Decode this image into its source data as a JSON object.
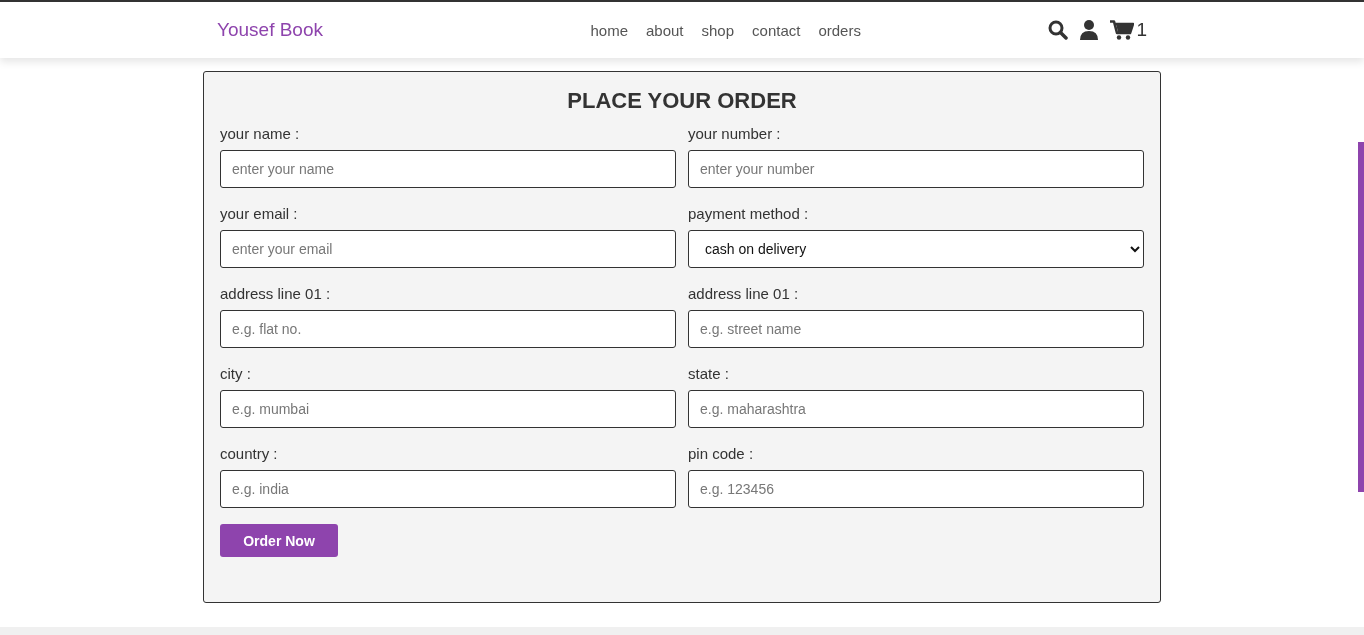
{
  "header": {
    "logo": "Yousef Book",
    "nav": [
      {
        "label": "home"
      },
      {
        "label": "about"
      },
      {
        "label": "shop"
      },
      {
        "label": "contact"
      },
      {
        "label": "orders"
      }
    ],
    "cart_count": "1"
  },
  "form": {
    "title": "PLACE YOUR ORDER",
    "fields": [
      {
        "kind": "input",
        "label": "your name :",
        "placeholder": "enter your name"
      },
      {
        "kind": "input",
        "label": "your number :",
        "placeholder": "enter your number"
      },
      {
        "kind": "input",
        "label": "your email :",
        "placeholder": "enter your email"
      },
      {
        "kind": "select",
        "label": "payment method :",
        "value": "cash on delivery"
      },
      {
        "kind": "input",
        "label": "address line 01 :",
        "placeholder": "e.g. flat no."
      },
      {
        "kind": "input",
        "label": "address line 01 :",
        "placeholder": "e.g. street name"
      },
      {
        "kind": "input",
        "label": "city :",
        "placeholder": "e.g. mumbai"
      },
      {
        "kind": "input",
        "label": "state :",
        "placeholder": "e.g. maharashtra"
      },
      {
        "kind": "input",
        "label": "country :",
        "placeholder": "e.g. india"
      },
      {
        "kind": "input",
        "label": "pin code :",
        "placeholder": "e.g. 123456"
      }
    ],
    "submit": "Order Now"
  }
}
